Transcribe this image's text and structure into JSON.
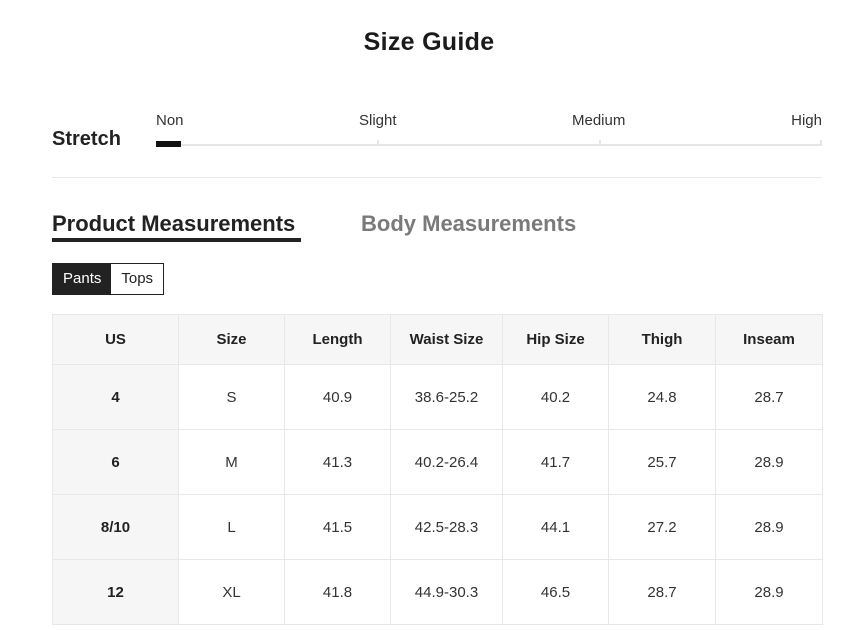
{
  "title": "Size Guide",
  "stretch": {
    "label": "Stretch",
    "levels": [
      "Non",
      "Slight",
      "Medium",
      "High"
    ],
    "selected": "Non"
  },
  "tabs": [
    {
      "label": "Product Measurements",
      "active": true
    },
    {
      "label": "Body Measurements",
      "active": false
    }
  ],
  "segments": [
    {
      "label": "Pants",
      "active": true
    },
    {
      "label": "Tops",
      "active": false
    }
  ],
  "table": {
    "headers": [
      "US",
      "Size",
      "Length",
      "Waist Size",
      "Hip Size",
      "Thigh",
      "Inseam"
    ],
    "rows": [
      [
        "4",
        "S",
        "40.9",
        "38.6-25.2",
        "40.2",
        "24.8",
        "28.7"
      ],
      [
        "6",
        "M",
        "41.3",
        "40.2-26.4",
        "41.7",
        "25.7",
        "28.9"
      ],
      [
        "8/10",
        "L",
        "41.5",
        "42.5-28.3",
        "44.1",
        "27.2",
        "28.9"
      ],
      [
        "12",
        "XL",
        "41.8",
        "44.9-30.3",
        "46.5",
        "28.7",
        "28.9"
      ]
    ]
  },
  "colors": {
    "accent": "#222222",
    "muted": "#7a7a7a",
    "header_bg": "#f6f6f6",
    "border": "#e8e8e8"
  }
}
